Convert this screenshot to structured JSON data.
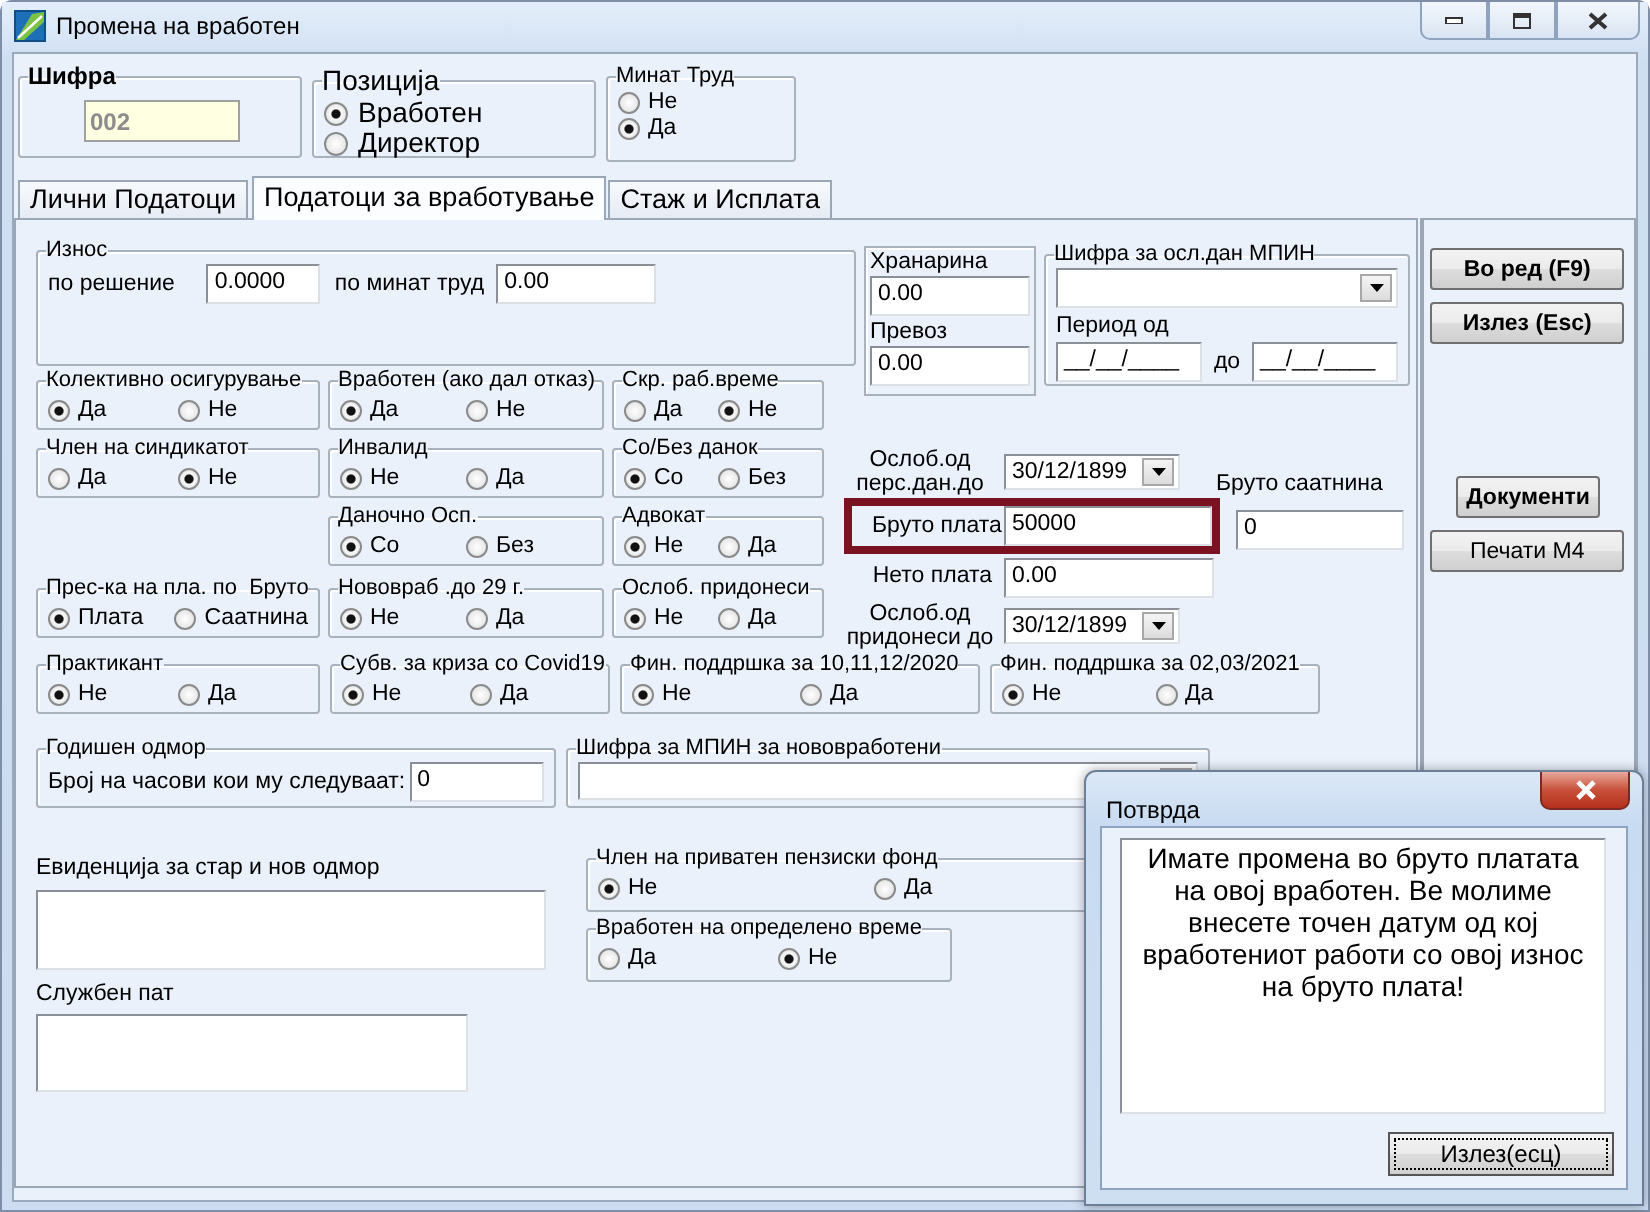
{
  "window": {
    "title": "Промена на вработен"
  },
  "code_group": {
    "label": "Шифра",
    "value": "002",
    "disabled": true
  },
  "position_group": {
    "label": "Позиција",
    "options": [
      {
        "label": "Вработен",
        "selected": true
      },
      {
        "label": "Директор",
        "selected": false
      }
    ]
  },
  "past_work_group": {
    "label": "Минат Труд",
    "options": [
      {
        "label": "Не",
        "selected": false
      },
      {
        "label": "Да",
        "selected": true
      }
    ]
  },
  "tabs": [
    {
      "label": "Лични Податоци",
      "selected": false
    },
    {
      "label": "Податоци за вработување",
      "selected": true
    },
    {
      "label": "Стаж и Исплата",
      "selected": false
    }
  ],
  "amount_group": {
    "label": "Износ",
    "fields": [
      {
        "label": "по решение",
        "value": "0.0000"
      },
      {
        "label": "по минат труд",
        "value": "0.00"
      }
    ]
  },
  "allowances": [
    {
      "label": "Хранарина",
      "value": "0.00"
    },
    {
      "label": "Превоз",
      "value": "0.00"
    }
  ],
  "mpin_exempt_group": {
    "label": "Шифра за осл.дан МПИН",
    "period_label": "Период од",
    "date_from": "__/__/____",
    "to_label": "до",
    "date_to": "__/__/____"
  },
  "option_rows": [
    {
      "groups": [
        {
          "label": "Колективно осигурување",
          "options": [
            {
              "label": "Да",
              "selected": true
            },
            {
              "label": "Не",
              "selected": false
            }
          ]
        },
        {
          "label": "Вработен (ако дал отказ)",
          "options": [
            {
              "label": "Да",
              "selected": true
            },
            {
              "label": "Не",
              "selected": false
            }
          ]
        },
        {
          "label": "Скр. раб.време",
          "options": [
            {
              "label": "Да",
              "selected": false
            },
            {
              "label": "Не",
              "selected": true
            }
          ]
        }
      ]
    },
    {
      "groups": [
        {
          "label": "Член на синдикатот",
          "options": [
            {
              "label": "Да",
              "selected": false
            },
            {
              "label": "Не",
              "selected": true
            }
          ]
        },
        {
          "label": "Инвалид",
          "options": [
            {
              "label": "Не",
              "selected": true
            },
            {
              "label": "Да",
              "selected": false
            }
          ]
        },
        {
          "label": "Со/Без данок",
          "options": [
            {
              "label": "Со",
              "selected": true
            },
            {
              "label": "Без",
              "selected": false
            }
          ]
        }
      ]
    },
    {
      "groups": [
        {
          "label": "Даночно Осп.",
          "options": [
            {
              "label": "Со",
              "selected": true
            },
            {
              "label": "Без",
              "selected": false
            }
          ]
        },
        {
          "label": "Адвокат",
          "options": [
            {
              "label": "Не",
              "selected": true
            },
            {
              "label": "Да",
              "selected": false
            }
          ]
        }
      ]
    },
    {
      "groups": [
        {
          "label": "Прес-ка на пла. по  Бруто",
          "options": [
            {
              "label": "Плата",
              "selected": true
            },
            {
              "label": "Саатнина",
              "selected": false
            }
          ]
        },
        {
          "label": "Нововраб .до 29 г.",
          "options": [
            {
              "label": "Не",
              "selected": true
            },
            {
              "label": "Да",
              "selected": false
            }
          ]
        },
        {
          "label": "Ослоб. придонеси",
          "options": [
            {
              "label": "Не",
              "selected": true
            },
            {
              "label": "Да",
              "selected": false
            }
          ]
        }
      ]
    }
  ],
  "bottom_option_row": {
    "groups": [
      {
        "label": "Практикант",
        "options": [
          {
            "label": "Не",
            "selected": true
          },
          {
            "label": "Да",
            "selected": false
          }
        ]
      },
      {
        "label": "Субв. за криза со Covid19",
        "options": [
          {
            "label": "Не",
            "selected": true
          },
          {
            "label": "Да",
            "selected": false
          }
        ]
      },
      {
        "label": "Фин. поддршка за 10,11,12/2020",
        "options": [
          {
            "label": "Не",
            "selected": true
          },
          {
            "label": "Да",
            "selected": false
          }
        ]
      },
      {
        "label": "Фин. поддршка за 02,03/2021",
        "options": [
          {
            "label": "Не",
            "selected": true
          },
          {
            "label": "Да",
            "selected": false
          }
        ]
      }
    ]
  },
  "tax_exempt_until": {
    "label": "Ослоб.од перс.дан.до",
    "value": "30/12/1899"
  },
  "gross_hourly": {
    "label": "Бруто саатнина",
    "value": "0"
  },
  "gross_salary": {
    "label": "Бруто плата",
    "value": "50000",
    "highlighted": true
  },
  "net_salary": {
    "label": "Нето плата",
    "value": "0.00"
  },
  "contrib_exempt_until": {
    "label": "Ослоб.од придонеси до",
    "value": "30/12/1899"
  },
  "annual_leave_group": {
    "label": "Годишен одмор",
    "field_label": "Број на часови кои му следуваат:",
    "value": "0"
  },
  "mpin_new_group": {
    "label": "Шифра за МПИН за нововработени"
  },
  "leave_record": {
    "label": "Евиденција за стар и нов одмор"
  },
  "business_trip": {
    "label": "Службен пат"
  },
  "pension_fund_group": {
    "label": "Член на приватен пензиски фонд",
    "options": [
      {
        "label": "Не",
        "selected": true
      },
      {
        "label": "Да",
        "selected": false
      }
    ]
  },
  "fixed_term_group": {
    "label": "Вработен на определено време",
    "options": [
      {
        "label": "Да",
        "selected": false
      },
      {
        "label": "Не",
        "selected": true
      }
    ]
  },
  "main_buttons": [
    {
      "label": "Во ред (F9)",
      "bold": true
    },
    {
      "label": "Излез (Esc)",
      "bold": true
    }
  ],
  "extra_buttons": [
    {
      "label": "Документи",
      "bold": true
    },
    {
      "label": "Печати М4",
      "bold": false
    }
  ],
  "dialog": {
    "title": "Потврда",
    "message": "Имате промена во бруто платата на овој вработен. Ве молиме внесете точен датум од кој вработениот работи со овој износ на бруто плата!",
    "button": "Излез(есц)"
  }
}
